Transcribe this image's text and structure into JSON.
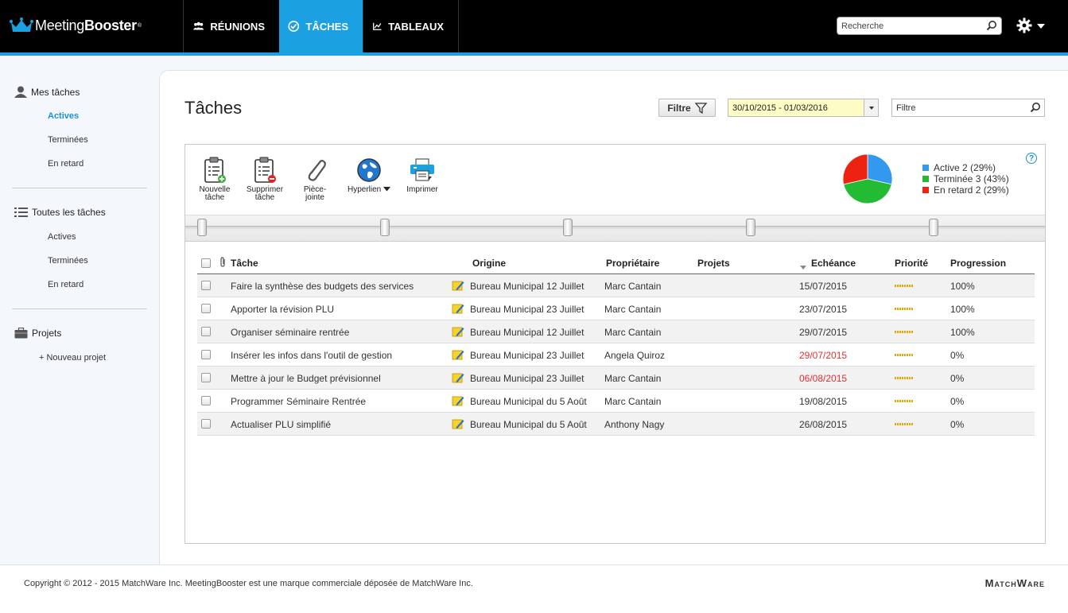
{
  "app": {
    "logo_main": "Meeting",
    "logo_bold": "Booster",
    "logo_mark": "®"
  },
  "nav": {
    "items": [
      {
        "label": "RÉUNIONS",
        "icon": "people-icon",
        "active": false
      },
      {
        "label": "TÂCHES",
        "icon": "check-circle-icon",
        "active": true
      },
      {
        "label": "TABLEAUX",
        "icon": "chart-line-icon",
        "active": false
      }
    ]
  },
  "search": {
    "placeholder": "Recherche"
  },
  "sidebar": {
    "my_tasks": {
      "label": "Mes tâches",
      "items": [
        "Actives",
        "Terminées",
        "En retard"
      ]
    },
    "all_tasks": {
      "label": "Toutes les tâches",
      "items": [
        "Actives",
        "Terminées",
        "En retard"
      ]
    },
    "projects": {
      "label": "Projets",
      "new_label": "+ Nouveau projet"
    }
  },
  "main": {
    "title": "Tâches",
    "filter_button": "Filtre",
    "date_range": "30/10/2015 - 01/03/2016",
    "filter_placeholder": "Filtre"
  },
  "toolbar": {
    "new_task": "Nouvelle tâche",
    "delete_task": "Supprimer tâche",
    "attachment": "Pièce-jointe",
    "hyperlink": "Hyperlien",
    "print": "Imprimer",
    "help": "?"
  },
  "stats": {
    "legend": [
      {
        "label": "Active 2 (29%)",
        "count": 2,
        "color": "#3399ee"
      },
      {
        "label": "Terminée 3 (43%)",
        "count": 3,
        "color": "#22bb33"
      },
      {
        "label": "En retard 2 (29%)",
        "count": 2,
        "color": "#ee2211"
      }
    ]
  },
  "table": {
    "headers": {
      "task": "Tâche",
      "origin": "Origine",
      "owner": "Propriétaire",
      "projects": "Projets",
      "due": "Echéance",
      "priority": "Priorité",
      "progress": "Progression"
    },
    "rows": [
      {
        "task": "Faire la synthèse des budgets des services",
        "origin": "Bureau Municipal 12 Juillet",
        "owner": "Marc Cantain",
        "project": "",
        "due": "15/07/2015",
        "overdue": false,
        "progress": "100%"
      },
      {
        "task": "Apporter la révision PLU",
        "origin": "Bureau Municipal 23 Juillet",
        "owner": "Marc Cantain",
        "project": "",
        "due": "23/07/2015",
        "overdue": false,
        "progress": "100%"
      },
      {
        "task": "Organiser séminaire rentrée",
        "origin": "Bureau Municipal 12 Juillet",
        "owner": "Marc Cantain",
        "project": "",
        "due": "29/07/2015",
        "overdue": false,
        "progress": "100%"
      },
      {
        "task": "Insérer les infos dans l'outil de gestion",
        "origin": "Bureau Municipal 23 Juillet",
        "owner": "Angela Quiroz",
        "project": "",
        "due": "29/07/2015",
        "overdue": true,
        "progress": "0%"
      },
      {
        "task": "Mettre à jour le Budget prévisionnel",
        "origin": "Bureau Municipal 23 Juillet",
        "owner": "Marc Cantain",
        "project": "",
        "due": "06/08/2015",
        "overdue": true,
        "progress": "0%"
      },
      {
        "task": "Programmer Séminaire Rentrée",
        "origin": "Bureau Municipal du 5 Août",
        "owner": "Marc Cantain",
        "project": "",
        "due": "19/08/2015",
        "overdue": false,
        "progress": "0%"
      },
      {
        "task": "Actualiser PLU simplifié",
        "origin": "Bureau Municipal du 5 Août",
        "owner": "Anthony Nagy",
        "project": "",
        "due": "26/08/2015",
        "overdue": false,
        "progress": "0%"
      }
    ]
  },
  "footer": {
    "copyright": "Copyright © 2012 - 2015 MatchWare Inc. MeetingBooster est une marque commerciale déposée de MatchWare Inc.",
    "brand": "MatchWare"
  }
}
